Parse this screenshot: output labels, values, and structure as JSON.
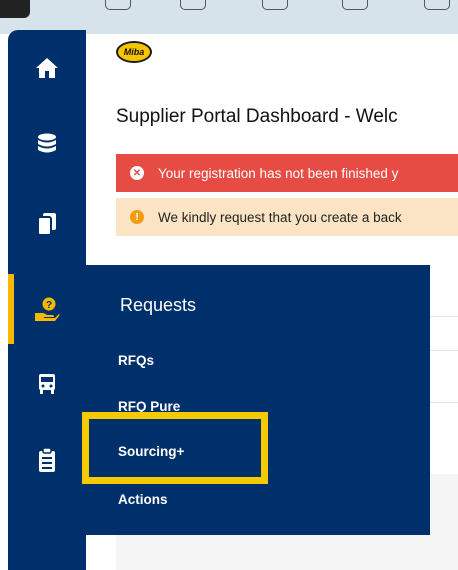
{
  "header": {
    "logo_text": "Miba"
  },
  "page": {
    "title": "Supplier Portal Dashboard - Welc"
  },
  "alerts": [
    {
      "type": "error",
      "icon": "close-circle-icon",
      "text": "Your registration has not been finished y"
    },
    {
      "type": "warning",
      "icon": "info-circle-icon",
      "text": "We kindly request that you create a back"
    }
  ],
  "sidebar": {
    "items": [
      {
        "name": "home",
        "icon": "home-icon"
      },
      {
        "name": "database",
        "icon": "database-icon"
      },
      {
        "name": "documents",
        "icon": "copy-icon"
      },
      {
        "name": "requests",
        "icon": "hand-question-icon",
        "active": true
      },
      {
        "name": "logistics",
        "icon": "truck-icon"
      },
      {
        "name": "tasks",
        "icon": "clipboard-icon"
      }
    ]
  },
  "flyout": {
    "title": "Requests",
    "items": [
      "RFQs",
      "RFQ Pure",
      "Sourcing+",
      "Actions"
    ]
  },
  "colors": {
    "sidebar": "#00306b",
    "accent": "#f7b900",
    "error": "#e74c44",
    "warning_bg": "#fbe4c4",
    "highlight": "#f7c900"
  }
}
